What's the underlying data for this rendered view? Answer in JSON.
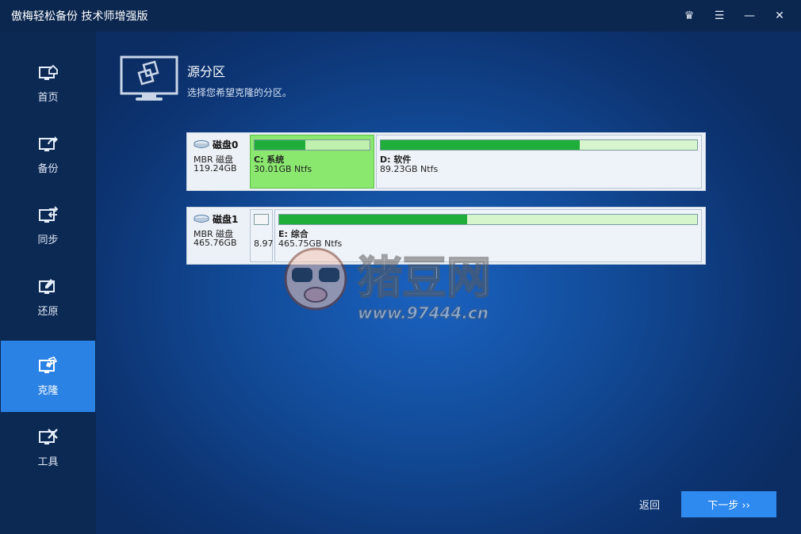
{
  "app": {
    "title": "傲梅轻松备份 技术师增强版"
  },
  "window_controls": [
    {
      "name": "crown-icon",
      "glyph": "♛"
    },
    {
      "name": "menu-icon",
      "glyph": "☰"
    },
    {
      "name": "minimize-icon",
      "glyph": "—"
    },
    {
      "name": "close-icon",
      "glyph": "✕"
    }
  ],
  "sidebar": {
    "items": [
      {
        "label": "首页",
        "icon": "home-monitor-icon"
      },
      {
        "label": "备份",
        "icon": "backup-monitor-icon"
      },
      {
        "label": "同步",
        "icon": "sync-monitor-icon"
      },
      {
        "label": "还原",
        "icon": "restore-monitor-icon"
      },
      {
        "label": "克隆",
        "icon": "clone-monitor-icon",
        "active": true
      },
      {
        "label": "工具",
        "icon": "tools-monitor-icon"
      }
    ]
  },
  "header": {
    "title": "源分区",
    "subtitle": "选择您希望克隆的分区。"
  },
  "disks": [
    {
      "name": "磁盘0",
      "type": "MBR 磁盘",
      "size": "119.24GB",
      "partitions": [
        {
          "name": "C: 系统",
          "info": "30.01GB Ntfs",
          "fill": 0.44,
          "selected": true
        },
        {
          "name": "D: 软件",
          "info": "89.23GB Ntfs",
          "fill": 0.63
        }
      ]
    },
    {
      "name": "磁盘1",
      "type": "MBR 磁盘",
      "size": "465.76GB",
      "partitions": [
        {
          "name": "",
          "info": "8.97",
          "fill": 0.0,
          "small": true
        },
        {
          "name": "E: 综合",
          "info": "465.75GB Ntfs",
          "fill": 0.45
        }
      ]
    }
  ],
  "watermark": {
    "brand": "猪豆网",
    "url": "www.97444.cn"
  },
  "footer": {
    "back_label": "返回",
    "next_label": "下一步 ››"
  },
  "colors": {
    "accent": "#2f8af0",
    "sidebar_active": "#2a82e4",
    "partition_selected": "#8be86f",
    "usage_fill": "#1fae3a"
  }
}
